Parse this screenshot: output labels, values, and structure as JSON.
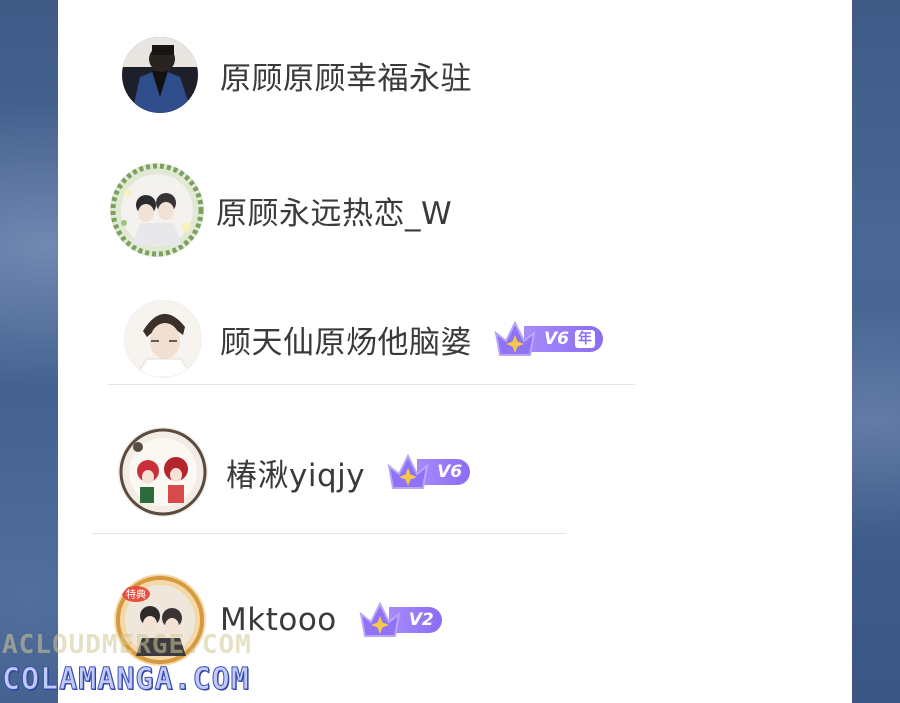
{
  "list": {
    "items": [
      {
        "name": "原顾原顾幸福永驻",
        "avatar_icon": "avatar-man-denim-jacket",
        "badge": null
      },
      {
        "name": "原顾永远热恋_W",
        "avatar_icon": "avatar-couple-flower-frame",
        "badge": null
      },
      {
        "name": "顾天仙原炀他脑婆",
        "avatar_icon": "avatar-man-portrait",
        "badge": {
          "level": "V6",
          "year_tag": "年"
        }
      },
      {
        "name": "椿湫yiqjy",
        "avatar_icon": "avatar-manga-characters",
        "badge": {
          "level": "V6"
        }
      },
      {
        "name": "Mktooo",
        "avatar_icon": "avatar-couple-special-frame",
        "badge": {
          "level": "V2"
        }
      }
    ]
  },
  "watermark": {
    "line1": "ACLOUDMERGE.COM",
    "line2": "COLAMANGA.COM"
  },
  "colors": {
    "background": "#445f8e",
    "panel": "#ffffff",
    "name_text": "#3a3a3a",
    "badge_purple": "#8b6cf4",
    "crown_gold": "#f5c84a"
  }
}
